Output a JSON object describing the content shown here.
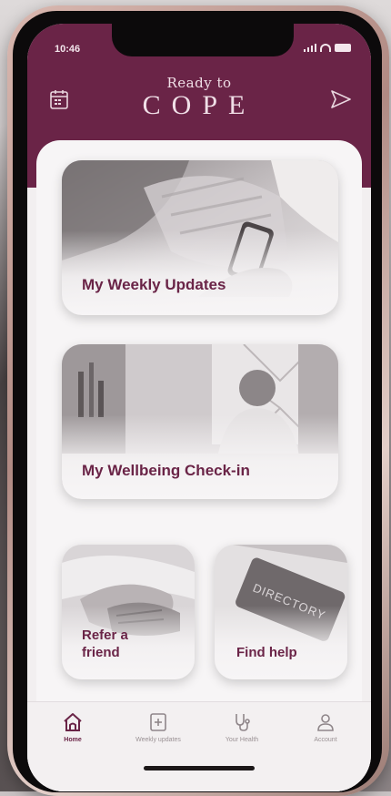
{
  "status_bar": {
    "time": "10:46"
  },
  "header": {
    "brand_top": "Ready to",
    "brand_main": "COPE",
    "left_icon": "calendar-icon",
    "right_icon": "send-icon",
    "color": "#6a2447"
  },
  "cards": {
    "weekly": {
      "label": "My Weekly Updates"
    },
    "wellbeing": {
      "label": "My Wellbeing Check-in"
    },
    "refer": {
      "label_line1": "Refer a",
      "label_line2": "friend"
    },
    "help": {
      "label": "Find help",
      "sign_text": "DIRECTORY"
    }
  },
  "tabbar": {
    "items": [
      {
        "label": "Home",
        "icon": "home-icon",
        "active": true
      },
      {
        "label": "Weekly updates",
        "icon": "plus-square-icon",
        "active": false
      },
      {
        "label": "Your Health",
        "icon": "stethoscope-icon",
        "active": false
      },
      {
        "label": "Account",
        "icon": "user-icon",
        "active": false
      }
    ]
  },
  "colors": {
    "accent": "#6a2447",
    "tab_inactive": "#9a9194"
  }
}
